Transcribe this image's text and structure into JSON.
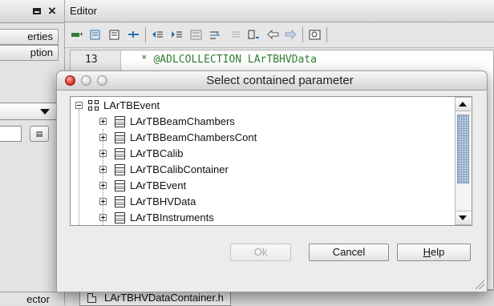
{
  "left_panel": {
    "tabs": [
      "erties",
      "ption"
    ],
    "bottom_text": "ector"
  },
  "editor": {
    "title": "Editor",
    "line_number": "13",
    "code": " * @ADLCOLLECTION LArTBHVData",
    "file_tab": "LArTBHVDataContainer.h"
  },
  "dialog": {
    "title": "Select contained parameter",
    "tree": {
      "root": "LArTBEvent",
      "children": [
        "LArTBBeamChambers",
        "LArTBBeamChambersCont",
        "LArTBCalib",
        "LArTBCalibContainer",
        "LArTBEvent",
        "LArTBHVData",
        "LArTBInstruments"
      ]
    },
    "buttons": {
      "ok": "Ok",
      "cancel": "Cancel",
      "help_prefix": "",
      "help_mnemonic": "H",
      "help_rest": "elp"
    }
  },
  "colors": {
    "code_comment": "#2e7d32",
    "scroll_thumb": "#bfd1e6",
    "close_red": "#e0352b"
  }
}
